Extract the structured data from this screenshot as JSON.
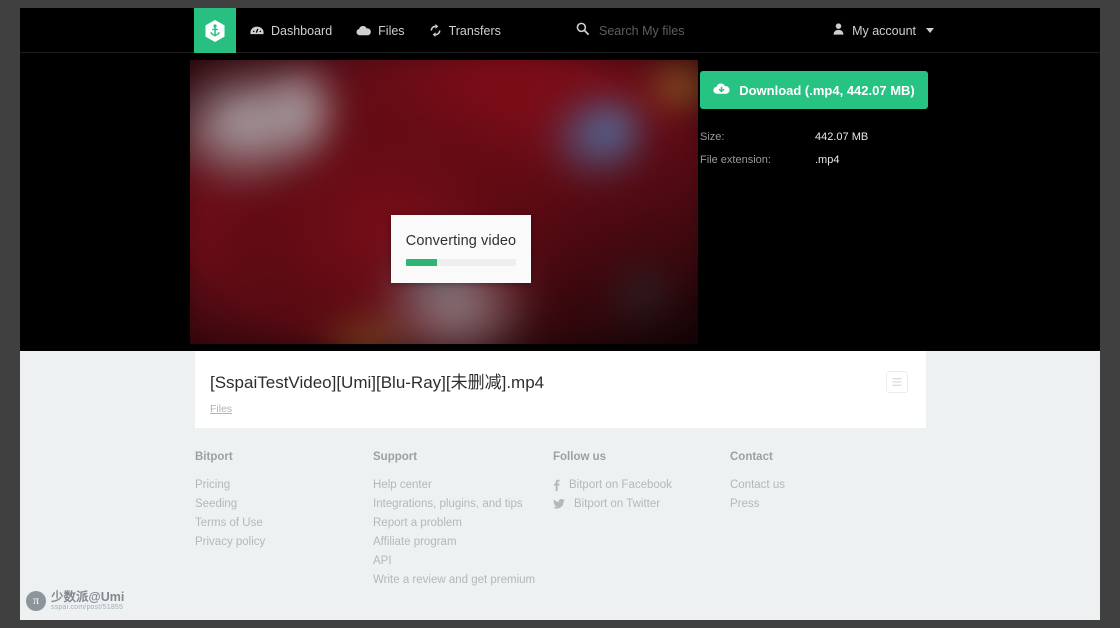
{
  "brand": {
    "logo_icon": "anchor-hexagon-icon",
    "accent_color": "#27c080"
  },
  "topnav": {
    "items": [
      {
        "label": "Dashboard",
        "icon": "dashboard-gauge-icon"
      },
      {
        "label": "Files",
        "icon": "cloud-icon"
      },
      {
        "label": "Transfers",
        "icon": "sync-arrows-icon"
      }
    ],
    "search": {
      "icon": "search-icon",
      "placeholder": "Search My files",
      "value": ""
    },
    "account": {
      "icon": "user-icon",
      "label": "My account",
      "caret": "chevron-down-icon"
    }
  },
  "hero": {
    "modal": {
      "title": "Converting video",
      "progress_percent": 28
    },
    "download": {
      "icon": "cloud-download-icon",
      "label": "Download (.mp4, 442.07 MB)",
      "color": "#27c382"
    },
    "meta": [
      {
        "key": "Size:",
        "value": "442.07 MB"
      },
      {
        "key": "File extension:",
        "value": ".mp4"
      }
    ]
  },
  "file_card": {
    "title": "[SspaiTestVideo][Umi][Blu-Ray][未删减].mp4",
    "breadcrumb": "Files",
    "menu_icon": "list-lines-icon"
  },
  "footer": {
    "columns": [
      {
        "heading": "Bitport",
        "links": [
          {
            "label": "Pricing",
            "icon": ""
          },
          {
            "label": "Seeding",
            "icon": ""
          },
          {
            "label": "Terms of Use",
            "icon": ""
          },
          {
            "label": "Privacy policy",
            "icon": ""
          }
        ]
      },
      {
        "heading": "Support",
        "links": [
          {
            "label": "Help center",
            "icon": ""
          },
          {
            "label": "Integrations, plugins, and tips",
            "icon": ""
          },
          {
            "label": "Report a problem",
            "icon": ""
          },
          {
            "label": "Affiliate program",
            "icon": ""
          },
          {
            "label": "API",
            "icon": ""
          },
          {
            "label": "Write a review and get premium",
            "icon": ""
          }
        ]
      },
      {
        "heading": "Follow us",
        "links": [
          {
            "label": "Bitport on Facebook",
            "icon": "facebook-icon"
          },
          {
            "label": "Bitport on Twitter",
            "icon": "twitter-icon"
          }
        ]
      },
      {
        "heading": "Contact",
        "links": [
          {
            "label": "Contact us",
            "icon": ""
          },
          {
            "label": "Press",
            "icon": ""
          }
        ]
      }
    ]
  },
  "watermark": {
    "badge": "π",
    "name": "少数派@Umi",
    "url": "sspai.com/post/51855"
  }
}
